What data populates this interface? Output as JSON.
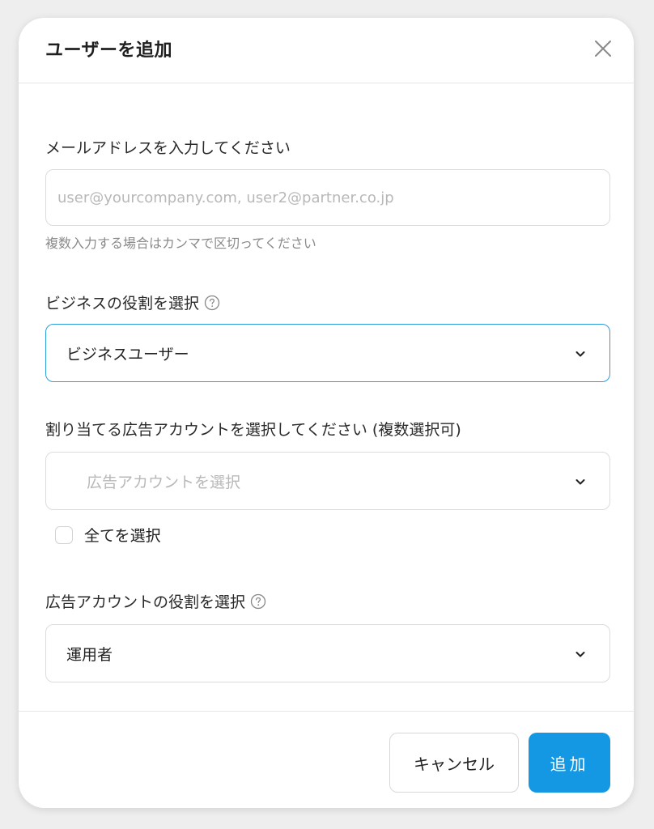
{
  "dialog": {
    "title": "ユーザーを追加",
    "close_icon": "close-icon"
  },
  "email": {
    "label": "メールアドレスを入力してください",
    "placeholder": "user@yourcompany.com, user2@partner.co.jp",
    "value": "",
    "hint": "複数入力する場合はカンマで区切ってください"
  },
  "business_role": {
    "label": "ビジネスの役割を選択",
    "help_icon": "help-circle-icon",
    "selected": "ビジネスユーザー"
  },
  "ad_accounts": {
    "label": "割り当てる広告アカウントを選択してください (複数選択可)",
    "placeholder": "広告アカウントを選択",
    "select_all_label": "全てを選択",
    "select_all_checked": false
  },
  "ad_account_role": {
    "label": "広告アカウントの役割を選択",
    "help_icon": "help-circle-icon",
    "selected": "運用者"
  },
  "footer": {
    "cancel_label": "キャンセル",
    "add_label": "追加"
  },
  "colors": {
    "primary": "#1598e3",
    "focus_border": "#2d9fdd",
    "border": "#dcdcdc"
  }
}
